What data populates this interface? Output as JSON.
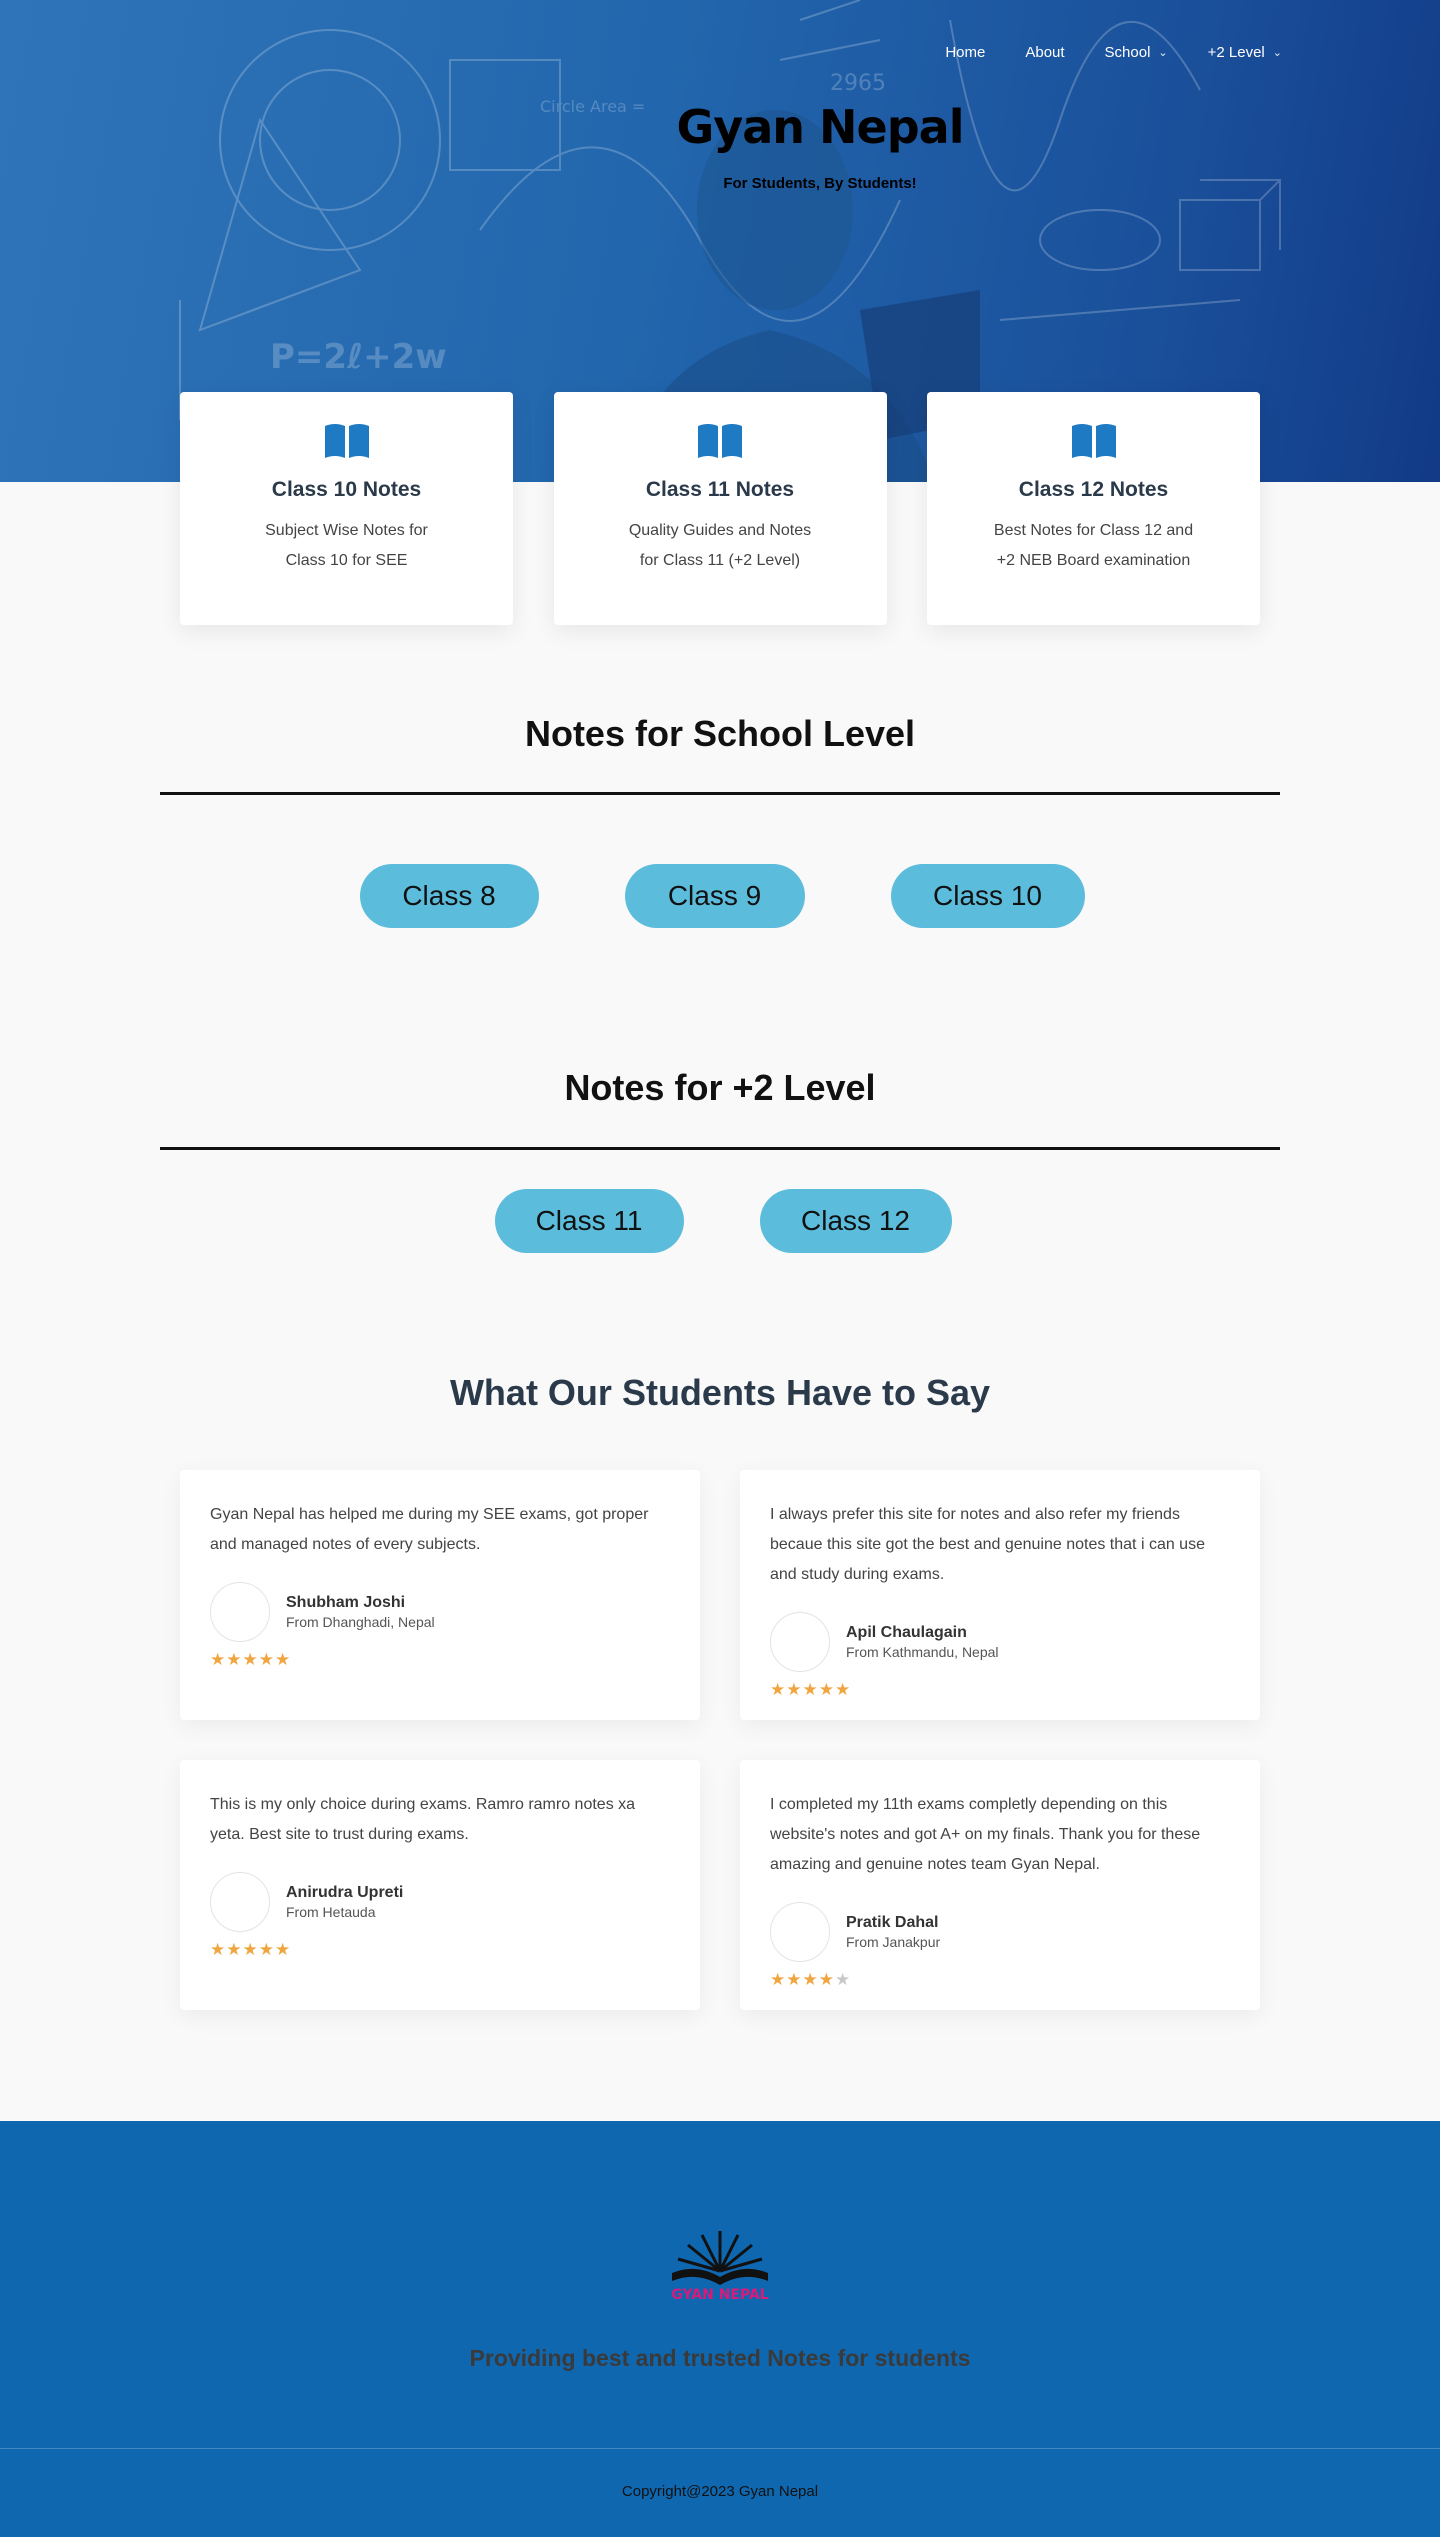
{
  "nav": {
    "items": [
      {
        "label": "Home",
        "has_dropdown": false
      },
      {
        "label": "About",
        "has_dropdown": false
      },
      {
        "label": "School",
        "has_dropdown": true
      },
      {
        "label": "+2 Level",
        "has_dropdown": true
      }
    ]
  },
  "hero": {
    "title": "Gyan Nepal",
    "tagline": "For Students, By Students!"
  },
  "features": [
    {
      "icon": "book-icon",
      "title": "Class 10 Notes",
      "text": "Subject Wise Notes for Class 10 for SEE"
    },
    {
      "icon": "book-icon",
      "title": "Class 11 Notes",
      "text": "Quality Guides and Notes for Class 11 (+2 Level)"
    },
    {
      "icon": "book-icon",
      "title": "Class 12 Notes",
      "text": "Best Notes for Class 12 and +2 NEB Board examination"
    }
  ],
  "school": {
    "title": "Notes for School Level",
    "buttons": [
      "Class 8",
      "Class 9",
      "Class 10"
    ]
  },
  "plus2": {
    "title": "Notes for +2 Level",
    "buttons": [
      "Class 11",
      "Class 12"
    ]
  },
  "testimonials": {
    "title": "What Our Students Have to Say",
    "items": [
      {
        "quote": "Gyan Nepal has helped me during my SEE exams, got proper and managed notes of every subjects.",
        "name": "Shubham Joshi",
        "from": "From Dhanghadi, Nepal",
        "rating": 5
      },
      {
        "quote": "I always prefer this site for notes and also refer my friends becaue this site got the best and genuine notes that i can use and study during exams.",
        "name": "Apil Chaulagain",
        "from": "From Kathmandu, Nepal",
        "rating": 5
      },
      {
        "quote": "This is my only choice during exams. Ramro ramro notes xa yeta. Best site to trust during exams.",
        "name": "Anirudra Upreti",
        "from": "From Hetauda",
        "rating": 5
      },
      {
        "quote": "I completed my 11th exams completly depending on this website's notes and got A+ on my finals. Thank you for these amazing and genuine notes team Gyan Nepal.",
        "name": "Pratik Dahal",
        "from": "From Janakpur",
        "rating": 4.5
      }
    ]
  },
  "footer": {
    "logo_text": "GYAN NEPAL",
    "slogan": "Providing best and trusted Notes for students",
    "copyright": "Copyright@2023 Gyan Nepal"
  },
  "colors": {
    "hero_blue": "#2266ad",
    "pill": "#5bbcdc",
    "icon_blue": "#1f7ac4",
    "star": "#f0a640",
    "footer_blue": "#0f67b0"
  }
}
